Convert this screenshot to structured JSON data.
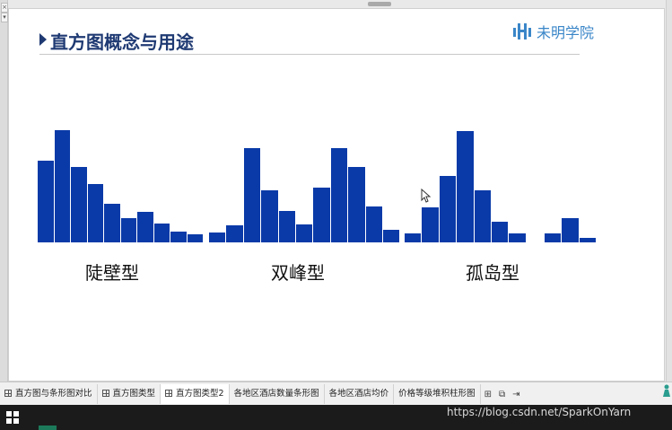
{
  "slide": {
    "title": "直方图概念与用途",
    "logo_text": "未明学院"
  },
  "chart_data": [
    {
      "type": "bar",
      "title": "陡壁型",
      "values": [
        9.5,
        13,
        8.7,
        6.8,
        4.5,
        2.8,
        3.5,
        2.2,
        1.3,
        0.9
      ]
    },
    {
      "type": "bar",
      "title": "双峰型",
      "values": [
        1.1,
        2.0,
        10.9,
        6.0,
        3.6,
        2.1,
        6.4,
        10.9,
        8.8,
        4.2,
        1.5
      ]
    },
    {
      "type": "bar",
      "title": "孤岛型",
      "values": [
        1.0,
        4.1,
        7.7,
        12.9,
        6.0,
        2.4,
        1.0,
        1.0,
        2.8,
        0.5
      ]
    }
  ],
  "sheet_tabs": [
    {
      "label": "直方图与条形图对比",
      "active": false
    },
    {
      "label": "直方图类型",
      "active": false
    },
    {
      "label": "直方图类型2",
      "active": true
    },
    {
      "label": "各地区酒店数量条形图",
      "active": false
    },
    {
      "label": "各地区酒店均价",
      "active": false
    },
    {
      "label": "价格等级堆积柱形图",
      "active": false
    }
  ],
  "sheet_buttons": [
    "new-sheet",
    "copy-sheet",
    "move-sheet"
  ],
  "watermark": "https://blog.csdn.net/SparkOnYarn",
  "colors": {
    "bar": "#0a3aa8",
    "title": "#1f3a73",
    "logo": "#3a86c8"
  }
}
